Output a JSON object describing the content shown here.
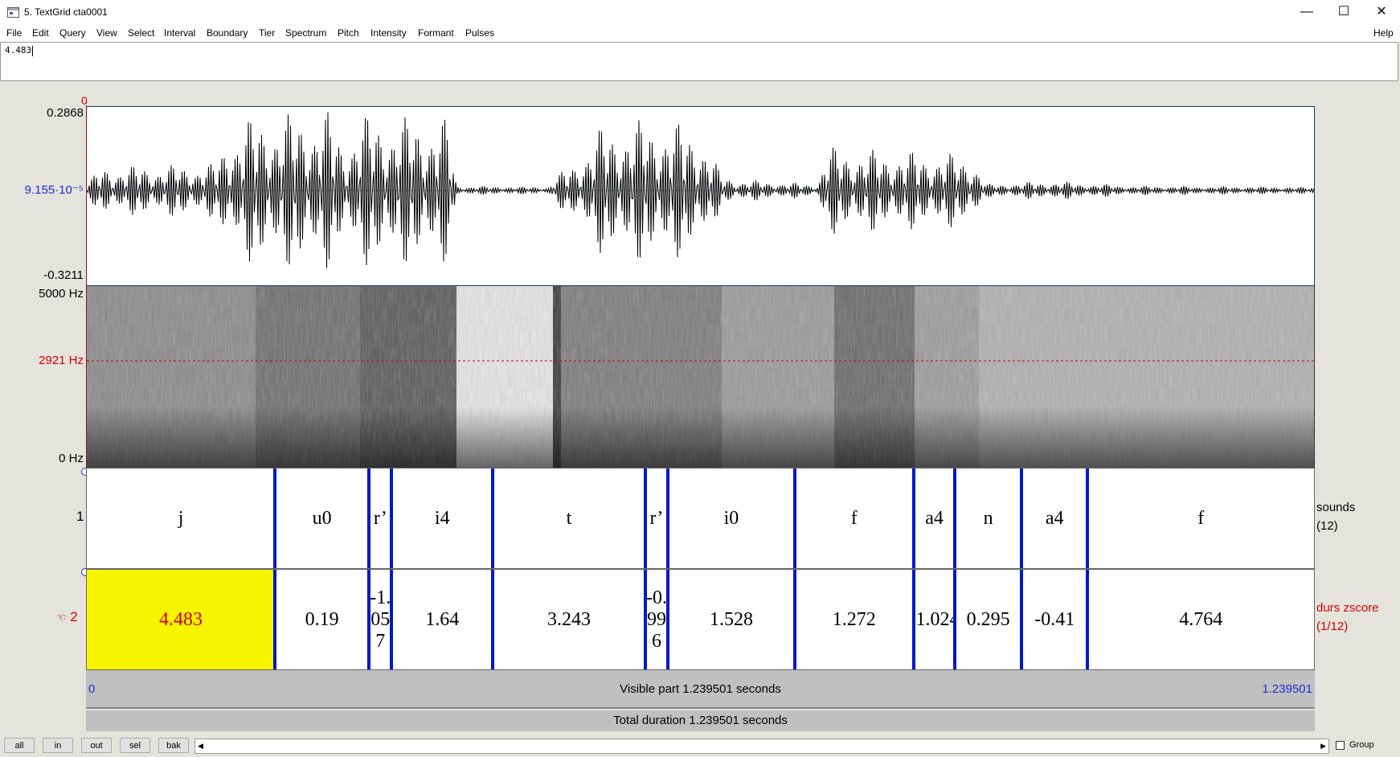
{
  "window": {
    "title": "5. TextGrid cta0001",
    "minimize_glyph": "—",
    "maximize_glyph": "☐",
    "close_glyph": "✕"
  },
  "menu": {
    "items": [
      "File",
      "Edit",
      "Query",
      "View",
      "Select",
      "Interval",
      "Boundary",
      "Tier",
      "Spectrum",
      "Pitch",
      "Intensity",
      "Formant",
      "Pulses"
    ],
    "help": "Help"
  },
  "text_field": {
    "value": "4.483"
  },
  "cursor_time": "0",
  "waveform": {
    "max": "0.2868",
    "mid": "9.155·10⁻⁵",
    "min": "-0.3211"
  },
  "spectrogram": {
    "top": "5000 Hz",
    "cursor": "2921 Hz",
    "bottom": "0 Hz"
  },
  "tiers": [
    {
      "number": "1",
      "name": "sounds",
      "count": "(12)",
      "intervals": [
        "j",
        "u0",
        "r’",
        "i4",
        "t",
        "r’",
        "i0",
        "f",
        "a4",
        "n",
        "a4",
        "f"
      ]
    },
    {
      "number": "2",
      "name": "durs zscore",
      "count": "(1/12)",
      "pointer_icon": "☜",
      "intervals": [
        "4.483",
        "0.19",
        "-1.057",
        "1.64",
        "3.243",
        "-0.996",
        "1.528",
        "1.272",
        "-1.024",
        "0.295",
        "-0.41",
        "4.764"
      ]
    }
  ],
  "boundaries_sec": [
    0.19,
    0.285,
    0.308,
    0.41,
    0.564,
    0.587,
    0.715,
    0.835,
    0.877,
    0.944,
    1.011
  ],
  "selected_interval": 0,
  "total_time_sec": 1.239501,
  "visible_bar": {
    "start": "0",
    "label": "Visible part 1.239501 seconds",
    "end": "1.239501"
  },
  "total_bar": {
    "label": "Total duration 1.239501 seconds"
  },
  "buttons": {
    "all": "all",
    "in": "in",
    "out": "out",
    "sel": "sel",
    "bak": "bak"
  },
  "scroll": {
    "left_arrow": "◀",
    "right_arrow": "▶"
  },
  "group": {
    "label": "Group",
    "checked": false
  },
  "colors": {
    "boundary": "#0018c8",
    "selection": "#f7f400",
    "selected_text": "#d10000",
    "cursor": "#d10000",
    "axis_blue": "#1a2fd6"
  }
}
